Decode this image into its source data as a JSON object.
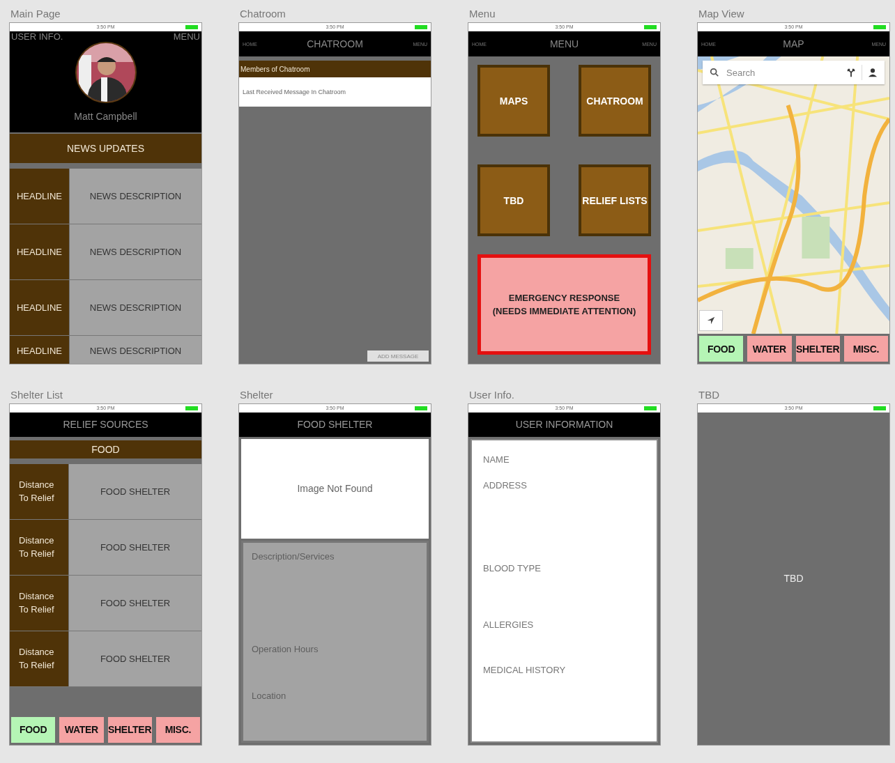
{
  "screens": [
    {
      "kind": "main",
      "label": "Main Page",
      "time": "3:50 PM",
      "left_link": "USER INFO.",
      "right_link": "MENU",
      "user_name": "Matt Campbell",
      "section": "NEWS UPDATES",
      "news": [
        {
          "headline": "HEADLINE",
          "description": "NEWS DESCRIPTION"
        },
        {
          "headline": "HEADLINE",
          "description": "NEWS DESCRIPTION"
        },
        {
          "headline": "HEADLINE",
          "description": "NEWS DESCRIPTION"
        },
        {
          "headline": "HEADLINE",
          "description": "NEWS DESCRIPTION"
        }
      ]
    },
    {
      "kind": "chat",
      "label": "Chatroom",
      "time": "3:50 PM",
      "home": "HOME",
      "title": "CHATROOM",
      "menu": "MENU",
      "members": "Members of Chatroom",
      "last_message": "Last Received Message In Chatroom",
      "add_button": "ADD MESSAGE"
    },
    {
      "kind": "menu",
      "label": "Menu",
      "time": "3:50 PM",
      "home": "HOME",
      "title": "MENU",
      "menu": "MENU",
      "tiles": [
        "MAPS",
        "CHATROOM",
        "TBD",
        "RELIEF LISTS"
      ],
      "alert_lines": [
        "EMERGENCY RESPONSE",
        "(NEEDS IMMEDIATE ATTENTION)"
      ]
    },
    {
      "kind": "map",
      "label": "Map View",
      "time": "3:50 PM",
      "home": "HOME",
      "title": "MAP",
      "menu": "MENU",
      "search": {
        "placeholder": "Search"
      },
      "filters": [
        {
          "label": "FOOD",
          "selected": true
        },
        {
          "label": "WATER",
          "selected": false
        },
        {
          "label": "SHELTER",
          "selected": false
        },
        {
          "label": "MISC.",
          "selected": false
        }
      ]
    },
    {
      "kind": "list",
      "label": "Shelter List",
      "time": "3:50 PM",
      "title": "RELIEF SOURCES",
      "category": "FOOD",
      "rows": [
        {
          "distance": "Distance To Relief",
          "name": "FOOD SHELTER"
        },
        {
          "distance": "Distance To Relief",
          "name": "FOOD SHELTER"
        },
        {
          "distance": "Distance To Relief",
          "name": "FOOD SHELTER"
        },
        {
          "distance": "Distance To Relief",
          "name": "FOOD SHELTER"
        }
      ],
      "filters": [
        {
          "label": "FOOD",
          "selected": true
        },
        {
          "label": "WATER",
          "selected": false
        },
        {
          "label": "SHELTER",
          "selected": false
        },
        {
          "label": "MISC.",
          "selected": false
        }
      ]
    },
    {
      "kind": "detail",
      "label": "Shelter",
      "time": "3:50 PM",
      "title": "FOOD SHELTER",
      "image_text": "Image Not Found",
      "fields": [
        "Description/Services",
        "Operation Hours",
        "Location"
      ]
    },
    {
      "kind": "user",
      "label": "User Info.",
      "time": "3:50 PM",
      "title": "USER INFORMATION",
      "fields": [
        "NAME",
        "ADDRESS",
        "BLOOD TYPE",
        "ALLERGIES",
        "MEDICAL HISTORY"
      ]
    },
    {
      "kind": "blank",
      "label": "TBD",
      "time": "3:50 PM",
      "body": "TBD"
    }
  ]
}
